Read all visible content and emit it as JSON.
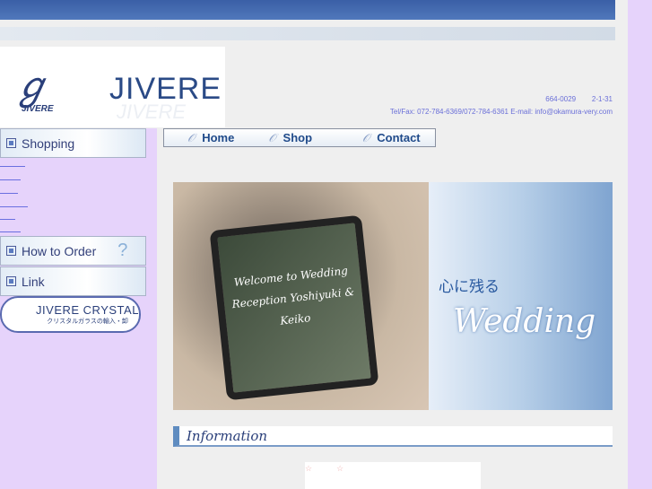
{
  "brand": {
    "logo_text": "JIVERE",
    "logo_sub": "JIVERE",
    "ghost": "JIVERE"
  },
  "contact": {
    "postal": "664-0029",
    "address": "2-1-31",
    "telfax": "Tel/Fax: 072-784-6369/072-784-6361",
    "email_label": "E-mail:",
    "email": "info@okamura-very.com"
  },
  "nav": [
    {
      "label": "Home"
    },
    {
      "label": "Shop"
    },
    {
      "label": "Contact"
    }
  ],
  "sidebar": {
    "shopping": "Shopping",
    "how_to_order": "How to Order",
    "link": "Link",
    "crystal_title": "JIVERE CRYSTAL",
    "crystal_sub": "クリスタルガラスの輸入・卸"
  },
  "banner": {
    "tagline": "心に残る",
    "wedding": "Wedding",
    "sign": "Welcome to Wedding Reception Yoshiyuki & Keiko"
  },
  "info": {
    "heading": "Information",
    "stars": "☆　　　☆"
  },
  "colors": {
    "accent": "#3a5fa6",
    "sidebar": "#e6d3fb"
  }
}
